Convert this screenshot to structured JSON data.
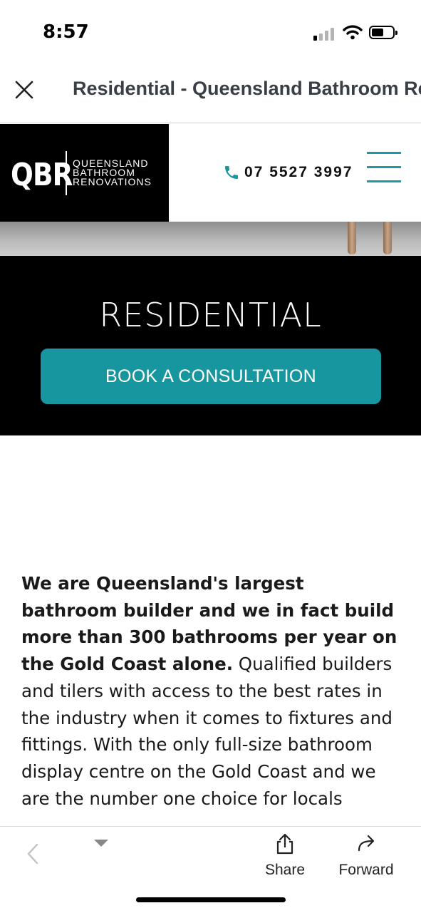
{
  "status_bar": {
    "time": "8:57"
  },
  "browser": {
    "page_title": "Residential - Queensland Bathroom Renovations"
  },
  "site": {
    "logo_mono": "QBR",
    "logo_lines": [
      "QUEENSLAND",
      "BATHROOM",
      "RENOVATIONS"
    ],
    "phone": "07 5527 3997",
    "accent_color": "#17969f"
  },
  "hero": {
    "title": "RESIDENTIAL",
    "cta_label": "BOOK A CONSULTATION"
  },
  "intro": {
    "bold_text": "We are Queensland's largest bathroom builder and we in fact build more than 300 bathrooms per year on the Gold Coast alone.",
    "body_text": " Qualified builders and tilers with access to the best rates in the industry when it comes to fixtures and fittings. With the only full-size bathroom display centre on the Gold Coast and we are the number one choice for locals"
  },
  "toolbar": {
    "share_label": "Share",
    "forward_label": "Forward"
  }
}
